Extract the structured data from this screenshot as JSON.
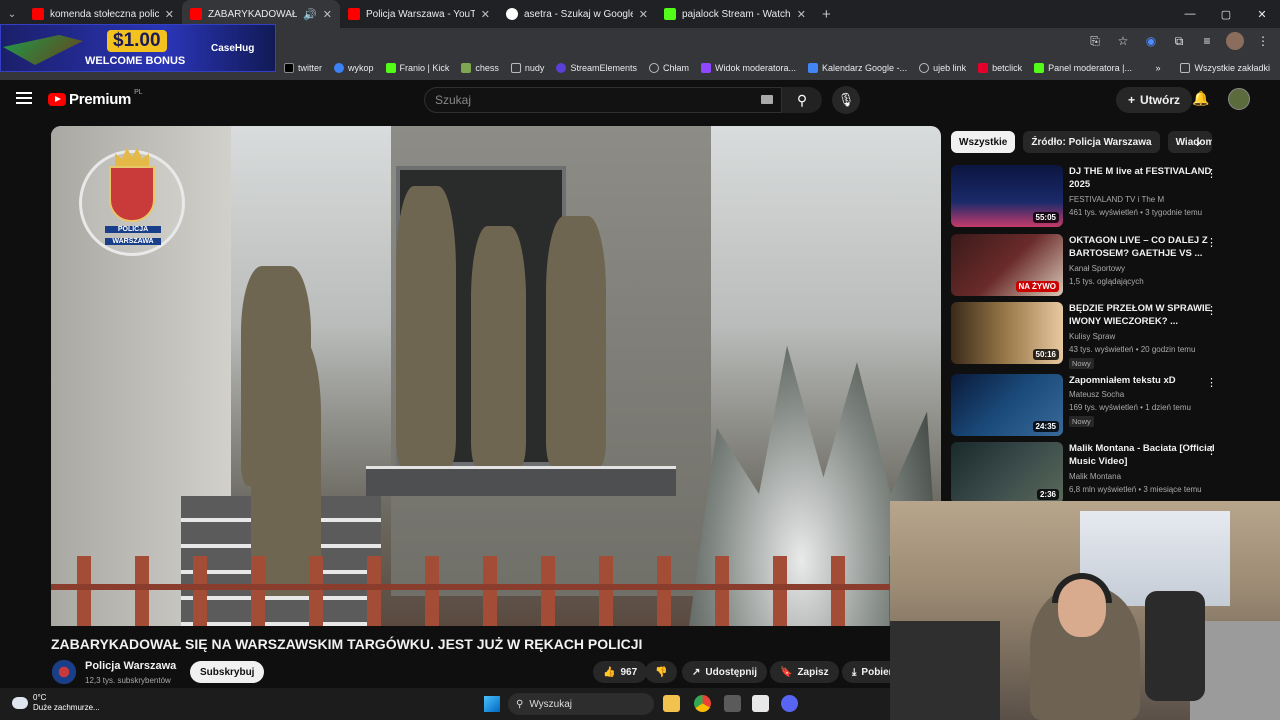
{
  "browser": {
    "tabs": [
      {
        "title": "komenda stołeczna policji - YouTube",
        "color": "#ff0000"
      },
      {
        "title": "ZABARYKADOWAŁ SIĘ NA WARSZAWSKIM",
        "color": "#ff0000"
      },
      {
        "title": "Policja Warszawa - YouTube",
        "color": "#ff0000"
      },
      {
        "title": "asetra - Szukaj w Google",
        "color": "#4285f4"
      },
      {
        "title": "pajalock Stream - Watch Live on Kick",
        "color": "#53fc18"
      }
    ],
    "bookmarks": [
      "twitter",
      "wykop",
      "Franio | Kick",
      "chess",
      "nudy",
      "StreamElements",
      "Chłam",
      "Widok moderatora...",
      "Kalendarz Google -...",
      "ujeb link",
      "betclick",
      "Panel moderatora |..."
    ],
    "bookmarks_all": "Wszystkie zakładki"
  },
  "ad": {
    "amount": "$1.00",
    "text": "WELCOME BONUS",
    "brand": "CaseHug"
  },
  "youtube": {
    "logo": "Premium",
    "region": "PL",
    "search_placeholder": "Szukaj",
    "create_label": "Utwórz"
  },
  "video": {
    "title": "ZABARYKADOWAŁ SIĘ NA WARSZAWSKIM TARGÓWKU. JEST JUŻ W RĘKACH POLICJI",
    "channel": "Policja Warszawa",
    "subscribers": "12,3 tys. subskrybentów",
    "subscribe_label": "Subskrybuj",
    "likes": "967",
    "share_label": "Udostępnij",
    "save_label": "Zapisz",
    "download_label": "Pobierz",
    "crest_label1": "POLICJA",
    "crest_label2": "WARSZAWA"
  },
  "chips": [
    "Wszystkie",
    "Źródło: Policja Warszawa",
    "Wiadomości"
  ],
  "recommendations": [
    {
      "title": "DJ THE M live at FESTIVALAND 2025",
      "channel": "FESTIVALAND TV i The M",
      "meta": "461 tys. wyświetleń • 3 tygodnie temu",
      "duration": "55:05",
      "badge": "",
      "thumb": "#1b2a6a"
    },
    {
      "title": "OKTAGON LIVE – CO DALEJ Z BARTOSEM? GAETHJE VS ...",
      "channel": "Kanał Sportowy",
      "meta": "1,5 tys. oglądających",
      "duration": "NA ŻYWO",
      "badge": "",
      "thumb": "#6a2a2a"
    },
    {
      "title": "BĘDZIE PRZEŁOM W SPRAWIE IWONY WIECZOREK? ...",
      "channel": "Kulisy Spraw",
      "meta": "43 tys. wyświetleń • 20 godzin temu",
      "duration": "50:16",
      "badge": "Nowy",
      "thumb": "#6b5a2a"
    },
    {
      "title": "Zapomniałem tekstu xD",
      "channel": "Mateusz Socha",
      "meta": "169 tys. wyświetleń • 1 dzień temu",
      "duration": "24:35",
      "badge": "Nowy",
      "thumb": "#1a4a7a"
    },
    {
      "title": "Malik Montana - Baciata [Official Music Video]",
      "channel": "Malik Montana",
      "meta": "6,8 mln wyświetleń • 3 miesiące temu",
      "duration": "2:36",
      "badge": "",
      "thumb": "#2a3a3a"
    }
  ],
  "taskbar": {
    "temp": "0°C",
    "weather": "Duże zachmurze...",
    "search": "Wyszukaj"
  }
}
